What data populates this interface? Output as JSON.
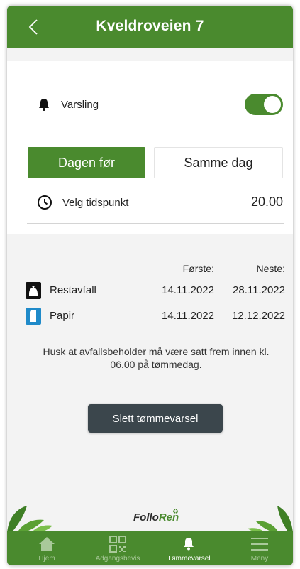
{
  "header": {
    "title": "Kveldroveien 7",
    "back_icon": "chevron-left-icon"
  },
  "notification": {
    "label": "Varsling",
    "enabled": true,
    "icon": "bell-icon"
  },
  "timing": {
    "options": [
      "Dagen før",
      "Samme dag"
    ],
    "selected": "Dagen før"
  },
  "time": {
    "label": "Velg tidspunkt",
    "value": "20.00",
    "icon": "clock-icon"
  },
  "schedule": {
    "columns": {
      "first": "Første:",
      "next": "Neste:"
    },
    "rows": [
      {
        "name": "Restavfall",
        "first": "14.11.2022",
        "next": "28.11.2022",
        "icon": "trash-bag-icon",
        "color": "#111111"
      },
      {
        "name": "Papir",
        "first": "14.11.2022",
        "next": "12.12.2022",
        "icon": "paper-icon",
        "color": "#1f8ac9"
      }
    ]
  },
  "notice": "Husk at avfallsbeholder må være satt frem innen kl. 06.00 på tømmedag.",
  "delete_button": "Slett tømmevarsel",
  "logo": {
    "part1": "Follo",
    "part2": "Ren"
  },
  "nav": {
    "items": [
      {
        "label": "Hjem",
        "icon": "home-icon"
      },
      {
        "label": "Adgangsbevis",
        "icon": "qr-code-icon"
      },
      {
        "label": "Tømmevarsel",
        "icon": "bell-icon",
        "active": true
      },
      {
        "label": "Meny",
        "icon": "menu-icon"
      }
    ]
  },
  "colors": {
    "brand_green": "#4a8a2e",
    "button_dark": "#3b464c",
    "background": "#f3f3f3"
  }
}
